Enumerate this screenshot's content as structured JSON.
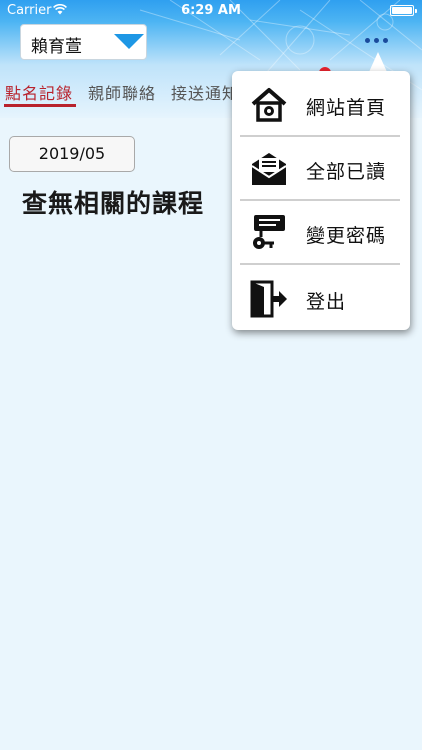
{
  "status_bar": {
    "carrier": "Carrier",
    "time": "6:29 AM"
  },
  "header": {
    "student_name": "賴育萱"
  },
  "tabs": [
    {
      "label": "點名記錄",
      "active": true
    },
    {
      "label": "親師聯絡",
      "active": false
    },
    {
      "label": "接送通知",
      "active": false
    }
  ],
  "content": {
    "month": "2019/05",
    "empty_message": "查無相關的課程"
  },
  "menu": {
    "items": [
      {
        "label": "網站首頁",
        "icon": "home-icon"
      },
      {
        "label": "全部已讀",
        "icon": "mail-read-icon"
      },
      {
        "label": "變更密碼",
        "icon": "key-password-icon"
      },
      {
        "label": "登出",
        "icon": "logout-door-icon"
      }
    ]
  },
  "colors": {
    "accent": "#1e97e5",
    "active_tab": "#b8222c",
    "badge": "#e8232f",
    "header_top": "#2f9ff0",
    "background": "#eaf6fd"
  }
}
